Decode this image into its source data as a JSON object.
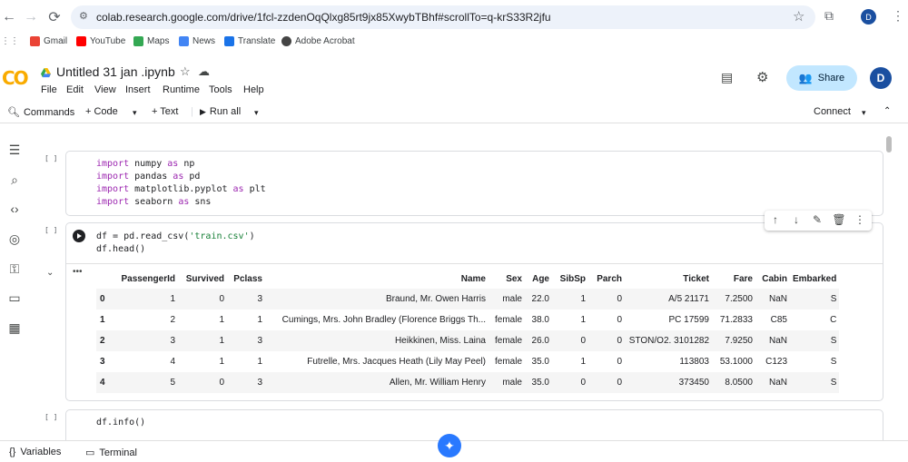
{
  "browser": {
    "url": "colab.research.google.com/drive/1fcl-zzdenOqQlxg85rt9jx85XwybTBhf#scrollTo=q-krS33R2jfu",
    "profile_initial": "D",
    "bookmarks": [
      {
        "label": "Gmail",
        "color": "#ea4335"
      },
      {
        "label": "YouTube",
        "color": "#ff0000"
      },
      {
        "label": "Maps",
        "color": "#34a853"
      },
      {
        "label": "News",
        "color": "#4285f4"
      },
      {
        "label": "Translate",
        "color": "#1a73e8"
      },
      {
        "label": "Adobe Acrobat",
        "color": "#444444"
      }
    ]
  },
  "colab": {
    "logo": "CO",
    "title": "Untitled 31 jan .ipynb",
    "menu": [
      "File",
      "Edit",
      "View",
      "Insert",
      "Runtime",
      "Tools",
      "Help"
    ],
    "share_label": "Share",
    "avatar_initial": "D",
    "toolbar": {
      "commands": "Commands",
      "code": "+ Code",
      "text": "+ Text",
      "run_all": "Run all",
      "connect": "Connect"
    }
  },
  "cells": {
    "cell1": {
      "bracket": "[ ]",
      "lines": [
        {
          "kw": "import",
          "rest1": " numpy ",
          "kw2": "as",
          "rest2": " np"
        },
        {
          "kw": "import",
          "rest1": " pandas ",
          "kw2": "as",
          "rest2": " pd"
        },
        {
          "kw": "import",
          "rest1": " matplotlib.pyplot ",
          "kw2": "as",
          "rest2": " plt"
        },
        {
          "kw": "import",
          "rest1": " seaborn ",
          "kw2": "as",
          "rest2": " sns"
        }
      ]
    },
    "cell2": {
      "bracket": "[ ]",
      "line1_a": "df = pd.read_csv(",
      "line1_str": "'train.csv'",
      "line1_b": ")",
      "line2": "df.head()",
      "output_menu": "•••"
    },
    "cell3": {
      "bracket": "[ ]",
      "line1": "df.info()"
    }
  },
  "table": {
    "columns": [
      "",
      "PassengerId",
      "Survived",
      "Pclass",
      "Name",
      "Sex",
      "Age",
      "SibSp",
      "Parch",
      "Ticket",
      "Fare",
      "Cabin",
      "Embarked"
    ],
    "rows": [
      [
        "0",
        "1",
        "0",
        "3",
        "Braund, Mr. Owen Harris",
        "male",
        "22.0",
        "1",
        "0",
        "A/5 21171",
        "7.2500",
        "NaN",
        "S"
      ],
      [
        "1",
        "2",
        "1",
        "1",
        "Cumings, Mrs. John Bradley (Florence Briggs Th...",
        "female",
        "38.0",
        "1",
        "0",
        "PC 17599",
        "71.2833",
        "C85",
        "C"
      ],
      [
        "2",
        "3",
        "1",
        "3",
        "Heikkinen, Miss. Laina",
        "female",
        "26.0",
        "0",
        "0",
        "STON/O2. 3101282",
        "7.9250",
        "NaN",
        "S"
      ],
      [
        "3",
        "4",
        "1",
        "1",
        "Futrelle, Mrs. Jacques Heath (Lily May Peel)",
        "female",
        "35.0",
        "1",
        "0",
        "113803",
        "53.1000",
        "C123",
        "S"
      ],
      [
        "4",
        "5",
        "0",
        "3",
        "Allen, Mr. William Henry",
        "male",
        "35.0",
        "0",
        "0",
        "373450",
        "8.0500",
        "NaN",
        "S"
      ]
    ]
  },
  "bottom": {
    "variables": "Variables",
    "terminal": "Terminal"
  }
}
